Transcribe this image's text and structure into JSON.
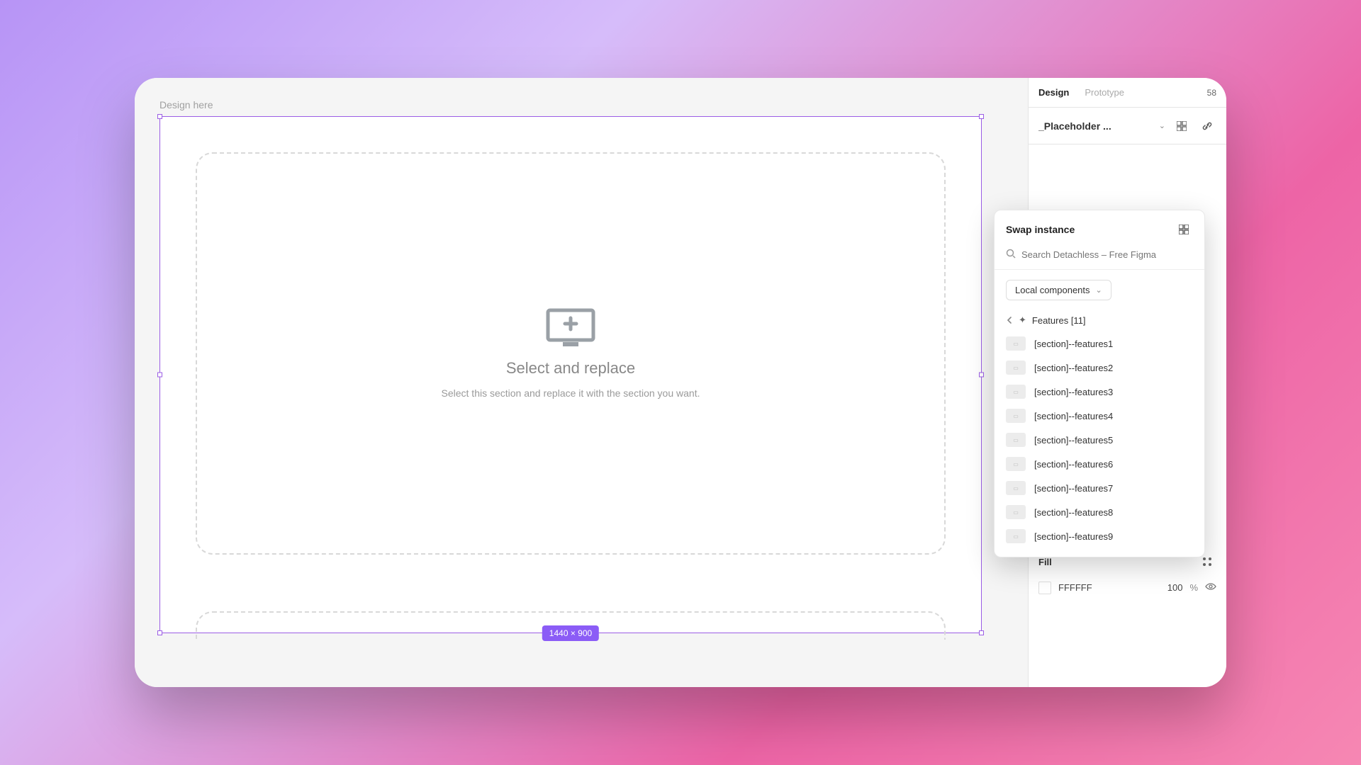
{
  "canvas": {
    "label": "Design here",
    "placeholder_title": "Select and replace",
    "placeholder_subtitle": "Select this section and replace it with the section you want.",
    "dimensions": "1440 × 900"
  },
  "inspector": {
    "tabs": {
      "design": "Design",
      "prototype": "Prototype",
      "number": "58"
    },
    "component_name": "_Placeholder ...",
    "fill": {
      "label": "Fill",
      "color_hex": "FFFFFF",
      "opacity_value": "100",
      "opacity_unit": "%"
    }
  },
  "swap": {
    "title": "Swap instance",
    "search_placeholder": "Search Detachless – Free Figma",
    "dropdown_label": "Local components",
    "breadcrumb_label": "Features [11]",
    "items": [
      "[section]--features1",
      "[section]--features2",
      "[section]--features3",
      "[section]--features4",
      "[section]--features5",
      "[section]--features6",
      "[section]--features7",
      "[section]--features8",
      "[section]--features9"
    ]
  }
}
